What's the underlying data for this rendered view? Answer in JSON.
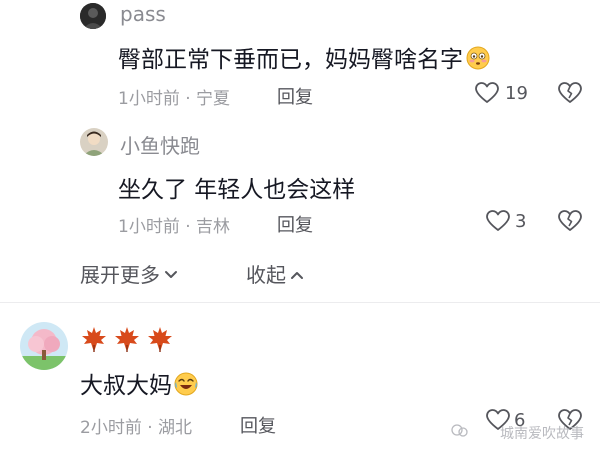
{
  "comments": [
    {
      "author": "pass",
      "text": "臀部正常下垂而已，妈妈臀啥名字",
      "emoji": "flushed-emoji",
      "time_location": "1小时前 · 宁夏",
      "reply_label": "回复",
      "likes": "19"
    },
    {
      "author": "小鱼快跑",
      "text": "坐久了 年轻人也会这样",
      "time_location": "1小时前 · 吉林",
      "reply_label": "回复",
      "likes": "3"
    },
    {
      "author": "",
      "decorations": [
        "maple-leaf-icon",
        "maple-leaf-icon",
        "maple-leaf-icon"
      ],
      "text": "大叔大妈",
      "emoji": "laughing-tears-emoji",
      "time_location": "2小时前 · 湖北",
      "reply_label": "回复",
      "likes": "6"
    }
  ],
  "toggles": {
    "expand_label": "展开更多",
    "collapse_label": "收起"
  },
  "watermark": {
    "text": "城南爱吹故事"
  },
  "colors": {
    "primary_text": "#161823",
    "secondary_text": "#8a8b91",
    "divider": "#ececee"
  }
}
